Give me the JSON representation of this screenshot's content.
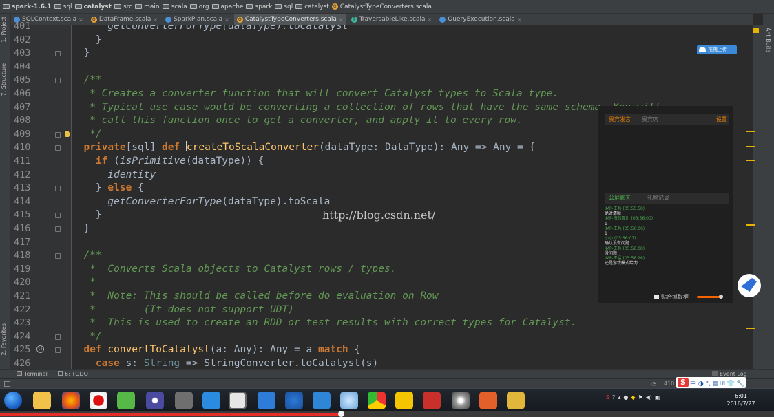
{
  "breadcrumb": [
    {
      "label": "spark-1.6.1",
      "icon": "project-icon",
      "bold": true
    },
    {
      "label": "sql",
      "icon": "folder-icon"
    },
    {
      "label": "catalyst",
      "icon": "folder-icon",
      "bold": true
    },
    {
      "label": "src",
      "icon": "folder-icon"
    },
    {
      "label": "main",
      "icon": "folder-icon"
    },
    {
      "label": "scala",
      "icon": "folder-icon"
    },
    {
      "label": "org",
      "icon": "folder-icon"
    },
    {
      "label": "apache",
      "icon": "folder-icon"
    },
    {
      "label": "spark",
      "icon": "folder-icon"
    },
    {
      "label": "sql",
      "icon": "folder-icon"
    },
    {
      "label": "catalyst",
      "icon": "folder-icon"
    },
    {
      "label": "CatalystTypeConverters.scala",
      "icon": "scala-object-icon"
    }
  ],
  "tabs": [
    {
      "label": "SQLContext.scala",
      "color": "#4a90d9",
      "letter": "",
      "active": false
    },
    {
      "label": "DataFrame.scala",
      "color": "#e8a33b",
      "letter": "O",
      "active": false
    },
    {
      "label": "SparkPlan.scala",
      "color": "#4a90d9",
      "letter": "",
      "active": false
    },
    {
      "label": "CatalystTypeConverters.scala",
      "color": "#e8a33b",
      "letter": "O",
      "active": true
    },
    {
      "label": "TraversableLike.scala",
      "color": "#3fb59b",
      "letter": "T",
      "active": false
    },
    {
      "label": "QueryExecution.scala",
      "color": "#4a90d9",
      "letter": "",
      "active": false
    }
  ],
  "left_tool_windows": [
    "1: Project",
    "7: Structure",
    "2: Favorites"
  ],
  "right_tool_windows": [
    "Ant Build"
  ],
  "editor": {
    "first_line_partial": "      getConverterForType(dataType).toCatalyst",
    "lines": [
      {
        "num": "401",
        "tokens": [
          {
            "t": "      getConverterForType(dataType).toCatalyst",
            "c": "it"
          }
        ]
      },
      {
        "num": "402",
        "tokens": [
          {
            "t": "    }",
            "c": ""
          }
        ]
      },
      {
        "num": "403",
        "tokens": [
          {
            "t": "  }",
            "c": ""
          }
        ]
      },
      {
        "num": "404",
        "tokens": [
          {
            "t": "",
            "c": ""
          }
        ]
      },
      {
        "num": "405",
        "tokens": [
          {
            "t": "  /**",
            "c": "com"
          }
        ]
      },
      {
        "num": "406",
        "tokens": [
          {
            "t": "   * Creates a converter function that will convert Catalyst types to Scala type.",
            "c": "com"
          }
        ]
      },
      {
        "num": "407",
        "tokens": [
          {
            "t": "   * Typical use case would be converting a collection of rows that have the same schema. You will",
            "c": "com"
          }
        ]
      },
      {
        "num": "408",
        "tokens": [
          {
            "t": "   * call this function once to get a converter, and apply it to every row.",
            "c": "com"
          }
        ]
      },
      {
        "num": "409",
        "tokens": [
          {
            "t": "   */",
            "c": "com"
          }
        ]
      },
      {
        "num": "410",
        "tokens": [
          {
            "t": "  private",
            "c": "kw"
          },
          {
            "t": "[sql] ",
            "c": ""
          },
          {
            "t": "def ",
            "c": "kw"
          },
          {
            "t": "CARET",
            "c": "caret"
          },
          {
            "t": "createToScalaConverter",
            "c": "fn"
          },
          {
            "t": "(dataType: DataType): Any => Any = {",
            "c": ""
          }
        ]
      },
      {
        "num": "411",
        "tokens": [
          {
            "t": "    ",
            "c": ""
          },
          {
            "t": "if ",
            "c": "kw"
          },
          {
            "t": "(",
            "c": ""
          },
          {
            "t": "isPrimitive",
            "c": "it"
          },
          {
            "t": "(dataType)) {",
            "c": ""
          }
        ]
      },
      {
        "num": "412",
        "tokens": [
          {
            "t": "      ",
            "c": ""
          },
          {
            "t": "identity",
            "c": "it"
          }
        ]
      },
      {
        "num": "413",
        "tokens": [
          {
            "t": "    } ",
            "c": ""
          },
          {
            "t": "else ",
            "c": "kw"
          },
          {
            "t": "{",
            "c": ""
          }
        ]
      },
      {
        "num": "414",
        "tokens": [
          {
            "t": "      ",
            "c": ""
          },
          {
            "t": "getConverterForType",
            "c": "it"
          },
          {
            "t": "(dataType).toScala",
            "c": ""
          }
        ]
      },
      {
        "num": "415",
        "tokens": [
          {
            "t": "    }",
            "c": ""
          }
        ]
      },
      {
        "num": "416",
        "tokens": [
          {
            "t": "  }",
            "c": ""
          }
        ]
      },
      {
        "num": "417",
        "tokens": [
          {
            "t": "",
            "c": ""
          }
        ]
      },
      {
        "num": "418",
        "tokens": [
          {
            "t": "  /**",
            "c": "com"
          }
        ]
      },
      {
        "num": "419",
        "tokens": [
          {
            "t": "   *  Converts Scala objects to Catalyst rows / types.",
            "c": "com"
          }
        ]
      },
      {
        "num": "420",
        "tokens": [
          {
            "t": "   *",
            "c": "com"
          }
        ]
      },
      {
        "num": "421",
        "tokens": [
          {
            "t": "   *  Note: This should be called before do evaluation on Row",
            "c": "com"
          }
        ]
      },
      {
        "num": "422",
        "tokens": [
          {
            "t": "   *        (It does not support UDT)",
            "c": "com"
          }
        ]
      },
      {
        "num": "423",
        "tokens": [
          {
            "t": "   *  This is used to create an RDD or test results with correct types for Catalyst.",
            "c": "com"
          }
        ]
      },
      {
        "num": "424",
        "tokens": [
          {
            "t": "   */",
            "c": "com"
          }
        ]
      },
      {
        "num": "425",
        "tokens": [
          {
            "t": "  def ",
            "c": "kw"
          },
          {
            "t": "convertToCatalyst",
            "c": "fn"
          },
          {
            "t": "(a: Any): Any = a ",
            "c": ""
          },
          {
            "t": "match ",
            "c": "kw"
          },
          {
            "t": "{",
            "c": ""
          }
        ]
      },
      {
        "num": "426",
        "tokens": [
          {
            "t": "    ",
            "c": ""
          },
          {
            "t": "case ",
            "c": "kw"
          },
          {
            "t": "s: ",
            "c": ""
          },
          {
            "t": "String",
            "c": "ty"
          },
          {
            "t": " => StringConverter.toCatalyst(s)",
            "c": ""
          }
        ]
      }
    ]
  },
  "watermark": "http://blog.csdn.net/",
  "upload_button": "拖拽上传",
  "chat_panel": {
    "tab1_active": "贵宾发言",
    "tab1_other": "贵宾席",
    "tab1_settings": "设置",
    "tab2_active": "公屏聊天",
    "tab2_other": "礼物记录",
    "messages": [
      {
        "user": "IMP-王兵 (05:55:58)",
        "text": "绝对清晰"
      },
      {
        "user": "IMP-海的面川 (05:56:00)",
        "text": "1"
      },
      {
        "user": "IMP-王兵 (05:56:06)",
        "text": "1"
      },
      {
        "user": "小小 (05:56:07)",
        "text": "确认没有问题"
      },
      {
        "user": "IMP-王兵 (05:56:08)",
        "text": "没问题"
      },
      {
        "user": "IMP-王猛 (05:56:26)",
        "text": "还是游戏模式给力"
      }
    ],
    "checkbox_label": "贴合抓取框"
  },
  "bottom_tools": {
    "terminal": "Terminal",
    "todo": "6: TODO",
    "event_log": "Event Log"
  },
  "status": {
    "position": "410"
  },
  "ime": {
    "logo": "S",
    "glyphs": "中 ◑ °, ▤ ⚿ 👕 🔧"
  },
  "clock": {
    "time": "6:01",
    "date": "2016/7/27"
  },
  "video_progress": 0.44,
  "colors": {
    "comment": "#629755",
    "keyword": "#cc7832",
    "function": "#ffc66d",
    "text": "#a9b7c6",
    "editor_bg": "#2b2b2b"
  }
}
